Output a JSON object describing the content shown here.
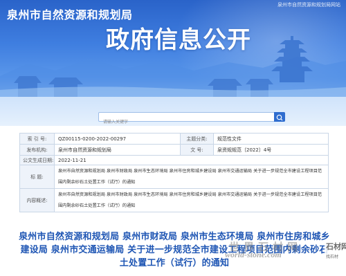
{
  "header": {
    "site_name": "泉州市自然资源和规划局",
    "banner_title": "政府信息公开",
    "top_right_text": "泉州市自然资源和规划局网站"
  },
  "search": {
    "placeholder": "请输入关键字"
  },
  "info": {
    "row1": {
      "label_a": "索  引  号:",
      "value_a": "QZ00115-0200-2022-00297",
      "label_b": "主题分类:",
      "value_b": "规范性文件"
    },
    "row2": {
      "label_a": "发布机构:",
      "value_a": "泉州市自然资源和规划局",
      "label_b": "文    号:",
      "value_b": "泉资规规范〔2022〕4号"
    },
    "row3": {
      "label": "公文生成日期:",
      "value": "2022-11-21"
    },
    "row4": {
      "label": "标    题:",
      "value": "泉州市自然资源和规划局 泉州市财政局 泉州市生态环境局 泉州市住房和城乡建设局 泉州市交通运输局 关于进一步规范全市建设工程项目范围内剩余砂石土处置工作（试行）的通知"
    },
    "row5": {
      "label": "内容概述:",
      "value": "泉州市自然资源和规划局 泉州市财政局 泉州市生态环境局 泉州市住房和城乡建设局 泉州市交通运输局 关于进一步规范全市建设工程项目范围内剩余砂石土处置工作（试行）的通知"
    }
  },
  "document": {
    "title": "泉州市自然资源和规划局 泉州市财政局 泉州市生态环境局 泉州市住房和城乡建设局 泉州市交通运输局 关于进一步规范全市建设工程项目范围内剩余砂石土处置工作（试行）的通知"
  },
  "watermark": {
    "chinese": "世界石材网",
    "url": "world-stone.com",
    "logo_top": "石材网",
    "logo_bottom": "找石材"
  },
  "colors": {
    "banner_blue": "#2a63c9",
    "title_blue": "#1f56b4",
    "table_border": "#c9d6e6",
    "label_bg": "#eef3fa"
  }
}
